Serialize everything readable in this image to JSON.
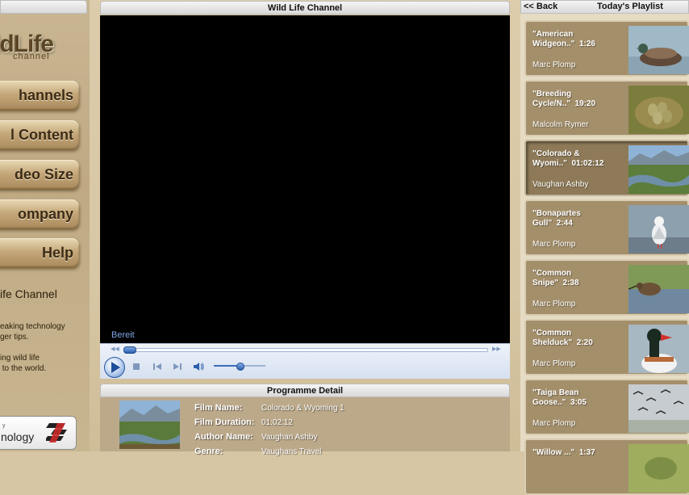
{
  "logo": {
    "main": "ldLife",
    "sub": "channel"
  },
  "nav": [
    {
      "label": "hannels"
    },
    {
      "label": "l Content"
    },
    {
      "label": "deo Size"
    },
    {
      "label": "ompany"
    },
    {
      "label": "Help"
    }
  ],
  "about": {
    "title": "ife Channel",
    "text": "eaking technology\nger tips.\n\ning wild life\n to the world."
  },
  "tech_badge": {
    "small": "y",
    "big": "nology"
  },
  "player": {
    "title": "Wild Life Channel",
    "status": "Bereit",
    "progress": 0.0,
    "volume": 0.5
  },
  "detail": {
    "title": "Programme Detail",
    "fields": [
      {
        "label": "Film Name:",
        "value": "Colorado & Wyoming 1"
      },
      {
        "label": "Film Duration:",
        "value": "01:02:12"
      },
      {
        "label": "Author Name:",
        "value": "Vaughan Ashby"
      },
      {
        "label": "Genre:",
        "value": "Vaughans Travel"
      }
    ]
  },
  "playlist": {
    "back": "<< Back",
    "title": "Today's Playlist",
    "items": [
      {
        "name": "\"American\nWidgeon..\"  1:26",
        "author": "Marc Plomp",
        "thumb": "duck"
      },
      {
        "name": "\"Breeding\nCycle/N..\"  19:20",
        "author": "Malcolm Rymer",
        "thumb": "nest"
      },
      {
        "name": "\"Colorado &\nWyomi..\"  01:02:12",
        "author": "Vaughan Ashby",
        "thumb": "river",
        "active": true
      },
      {
        "name": "\"Bonapartes\nGull\"  2:44",
        "author": "Marc Plomp",
        "thumb": "gull"
      },
      {
        "name": "\"Common\nSnipe\"  2:38",
        "author": "Marc Plomp",
        "thumb": "snipe"
      },
      {
        "name": "\"Common\nShelduck\"  2:20",
        "author": "Marc Plomp",
        "thumb": "shelduck"
      },
      {
        "name": "\"Taiga Bean\nGoose..\"  3:05",
        "author": "Marc Plomp",
        "thumb": "geese"
      },
      {
        "name": "\"Willow ...\"  1:37",
        "author": "",
        "thumb": "green"
      }
    ]
  },
  "colors": {
    "accent": "#2c5fae",
    "panel": "#a48f6b"
  }
}
